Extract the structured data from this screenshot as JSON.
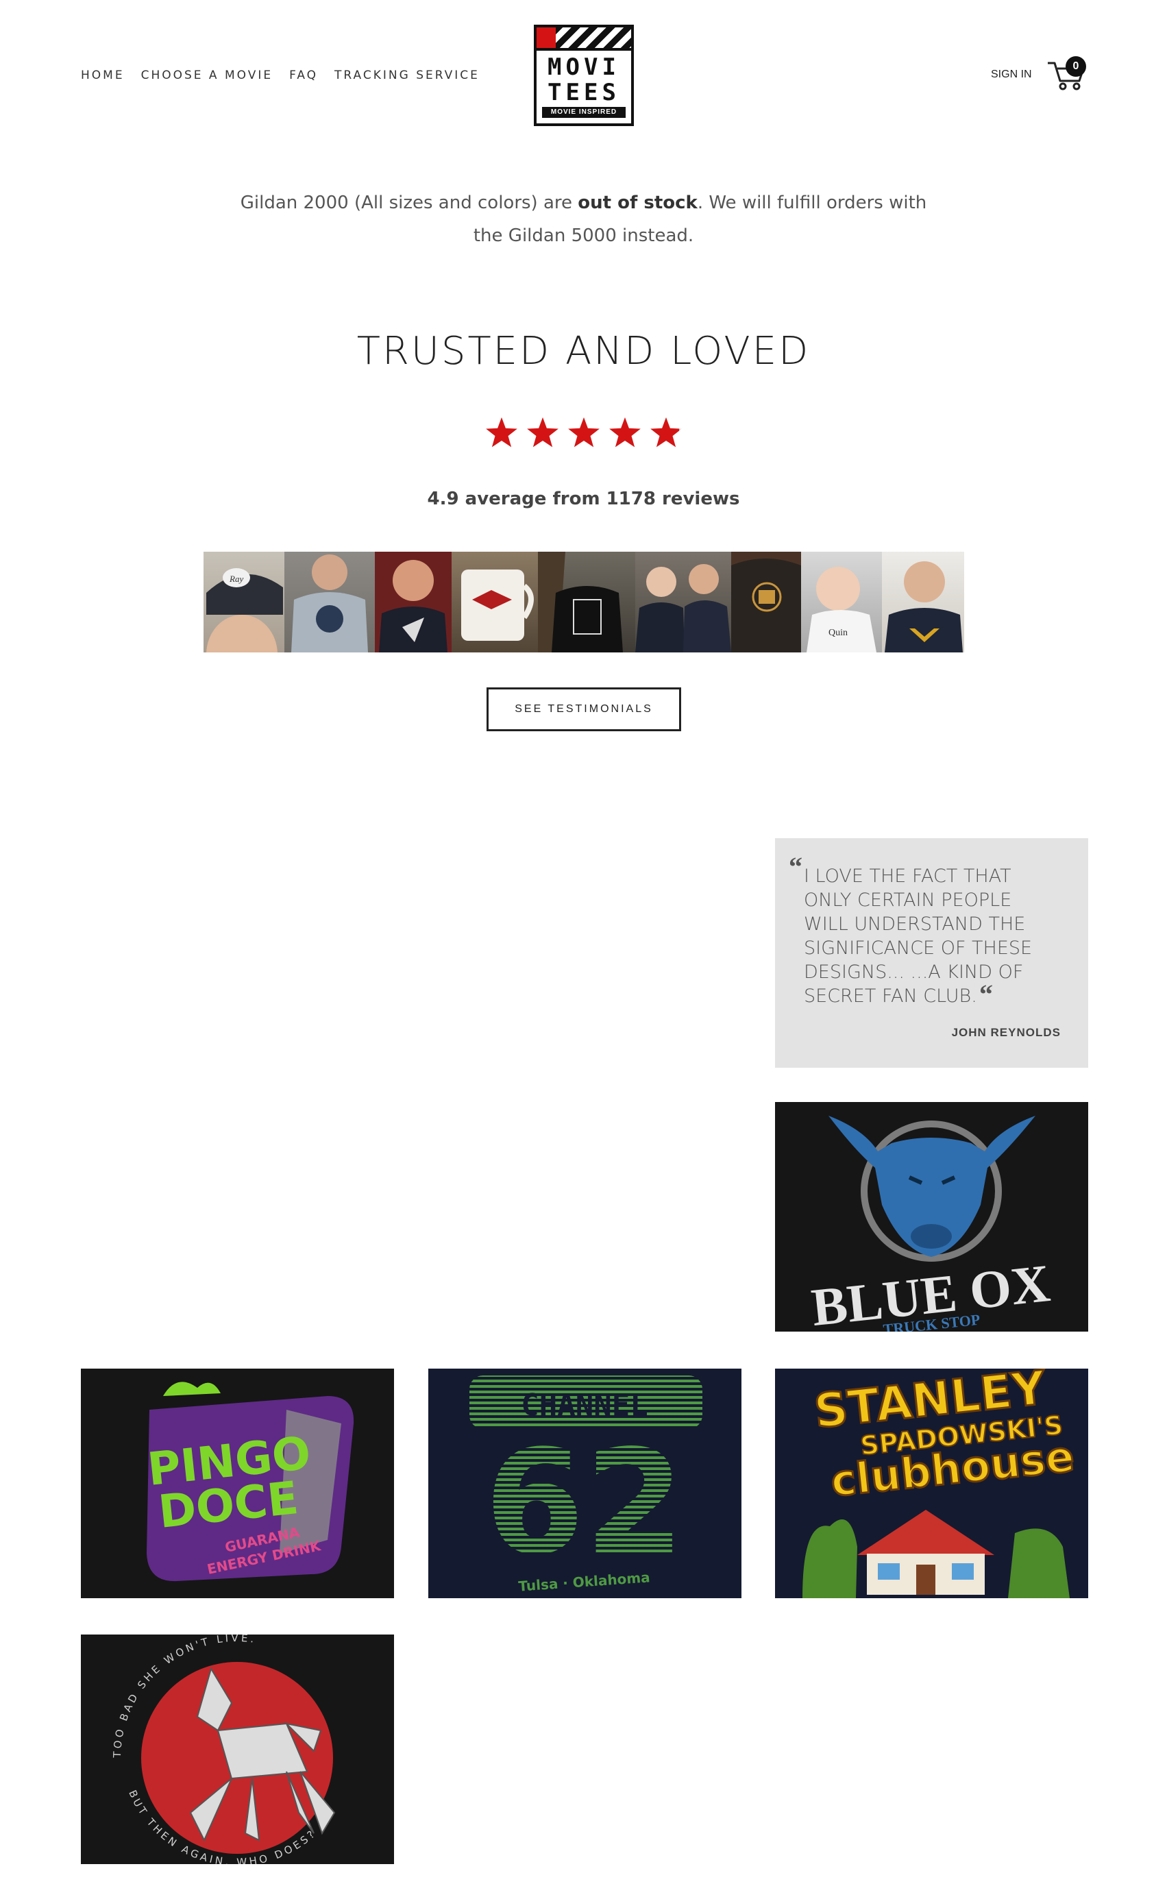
{
  "header": {
    "nav": [
      "HOME",
      "CHOOSE A MOVIE",
      "FAQ",
      "TRACKING SERVICE"
    ],
    "logo": {
      "line1": "MOVI",
      "line2": "TEES",
      "tagline": "MOVIE INSPIRED"
    },
    "sign_in": "SIGN IN",
    "cart_count": "0"
  },
  "notice": {
    "before": "Gildan 2000 (All sizes and colors) are ",
    "bold": "out of stock",
    "after": ". We will fulfill orders with the Gildan 5000 instead."
  },
  "reviews": {
    "title": "TRUSTED AND LOVED",
    "stars": 4.9,
    "summary": "4.9 average from 1178 reviews",
    "button": "SEE TESTIMONIALS"
  },
  "testimonial": {
    "quote": "I LOVE THE FACT THAT ONLY CERTAIN PEOPLE WILL UNDERSTAND THE SIGNIFICANCE OF THESE DESIGNS... ...A KIND OF SECRET FAN CLUB.",
    "author": "JOHN REYNOLDS"
  },
  "products": {
    "blue_ox": {
      "line1": "BLUE OX",
      "line2": "TRUCK STOP"
    },
    "pingo": {
      "line1": "PINGO",
      "line2": "DOCE",
      "sub1": "GUARANA",
      "sub2": "ENERGY DRINK"
    },
    "channel": {
      "word": "CHANNEL",
      "number": "62",
      "place": "Tulsa · Oklahoma"
    },
    "stanley": {
      "line1": "STANLEY",
      "line2": "SPADOWSKI'S",
      "line3": "clubhouse"
    },
    "unicorn": {
      "top": "TOO BAD SHE WON'T LIVE.",
      "bottom": "BUT THEN AGAIN, WHO DOES?"
    }
  },
  "colors": {
    "accent_red": "#d41414",
    "quote_bg": "#e3e3e3",
    "shirt_black": "#161616",
    "shirt_navy": "#141a30"
  }
}
